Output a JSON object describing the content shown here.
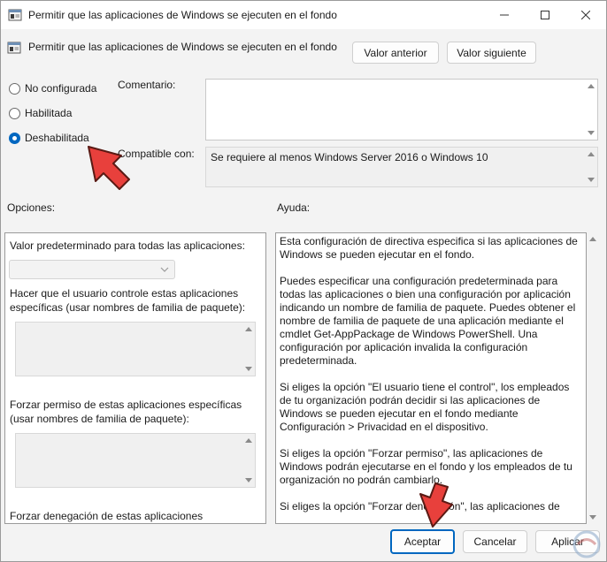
{
  "window": {
    "title": "Permitir que las aplicaciones de Windows se ejecuten en el fondo",
    "controls": [
      "minimize-icon",
      "maximize-icon",
      "close-icon"
    ]
  },
  "header": {
    "policy_title": "Permitir que las aplicaciones de Windows se ejecuten en el fondo",
    "prev_button": "Valor anterior",
    "next_button": "Valor siguiente"
  },
  "state": {
    "options": [
      {
        "label": "No configurada",
        "checked": false
      },
      {
        "label": "Habilitada",
        "checked": false
      },
      {
        "label": "Deshabilitada",
        "checked": true
      }
    ]
  },
  "comment": {
    "label": "Comentario:",
    "value": ""
  },
  "compat": {
    "label": "Compatible con:",
    "value": "Se requiere al menos Windows Server 2016 o Windows 10"
  },
  "sections": {
    "options_label": "Opciones:",
    "help_label": "Ayuda:"
  },
  "options_panel": {
    "default_label": "Valor predeterminado para todas las aplicaciones:",
    "default_value": "",
    "user_control_label": "Hacer que el usuario controle estas aplicaciones específicas (usar nombres de familia de paquete):",
    "force_allow_label": "Forzar permiso de estas aplicaciones específicas (usar nombres de familia de paquete):",
    "force_deny_label": "Forzar denegación de estas aplicaciones específicas"
  },
  "help": {
    "paragraphs": [
      "Esta configuración de directiva especifica si las aplicaciones de Windows se pueden ejecutar en el fondo.",
      "Puedes especificar una configuración predeterminada para todas las aplicaciones o bien una configuración por aplicación indicando un nombre de familia de paquete. Puedes obtener el nombre de familia de paquete de una aplicación mediante el cmdlet Get-AppPackage de Windows PowerShell. Una configuración por aplicación invalida la configuración predeterminada.",
      "Si eliges la opción \"El usuario tiene el control\", los empleados de tu organización podrán decidir si las aplicaciones de Windows se pueden ejecutar en el fondo mediante Configuración > Privacidad en el dispositivo.",
      "Si eliges la opción \"Forzar permiso\", las aplicaciones de Windows podrán ejecutarse en el fondo y los empleados de tu organización no podrán cambiarlo.",
      "Si eliges la opción \"Forzar denegación\", las aplicaciones de"
    ]
  },
  "footer": {
    "ok": "Aceptar",
    "cancel": "Cancelar",
    "apply": "Aplicar"
  },
  "colors": {
    "accent": "#0067c0",
    "annotation_arrow": "#e8403c"
  }
}
